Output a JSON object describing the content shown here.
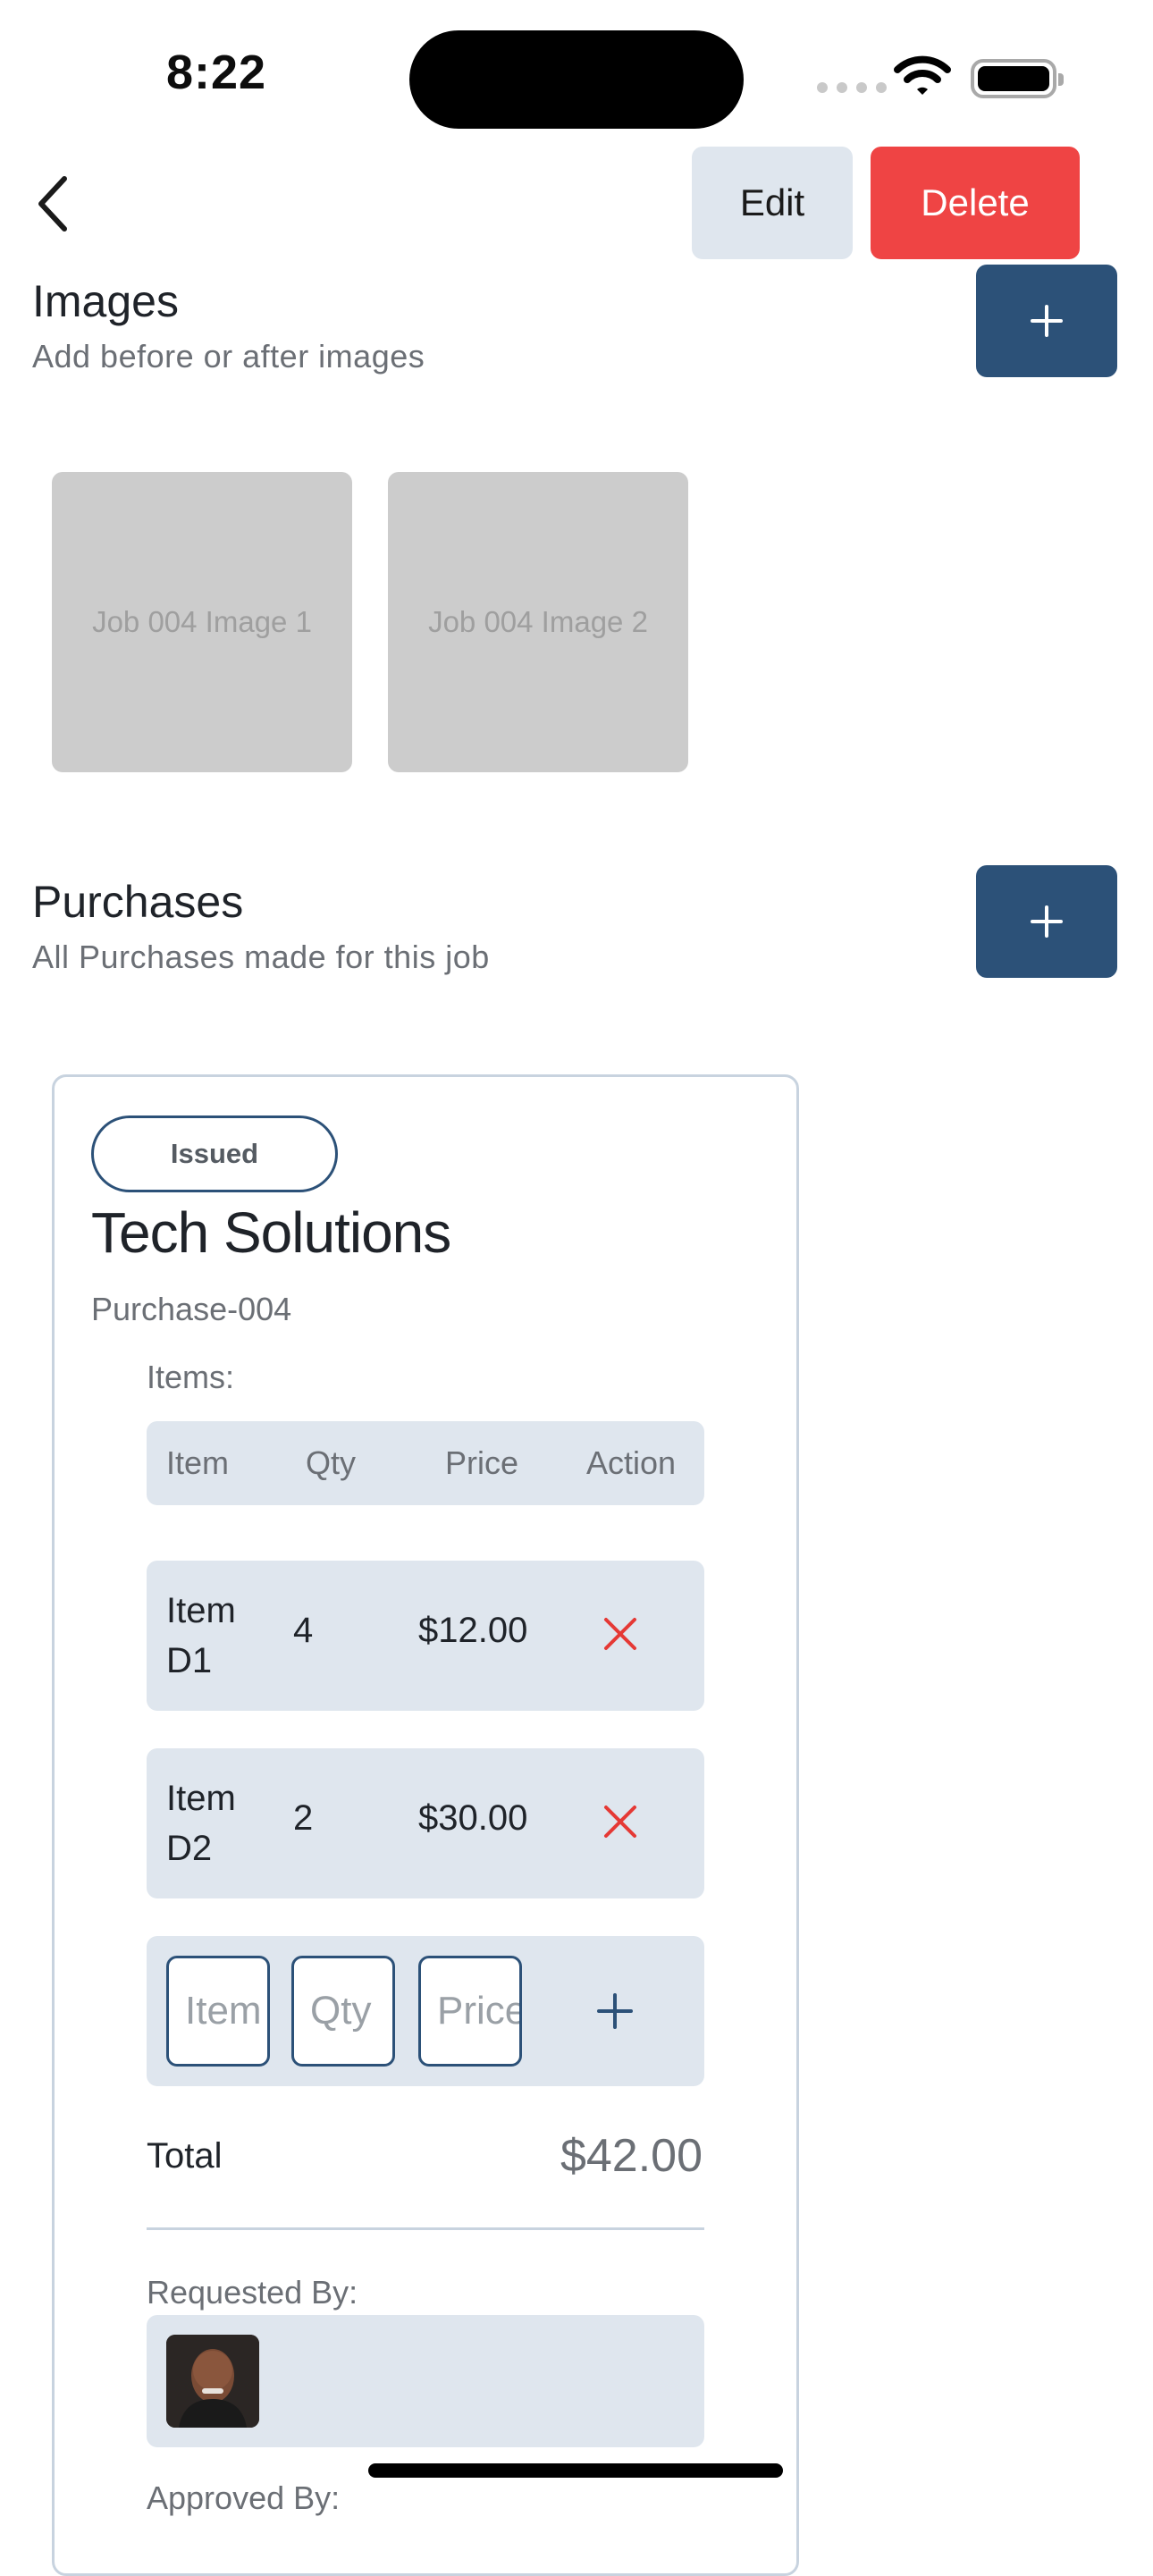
{
  "status_bar": {
    "time": "8:22"
  },
  "nav": {
    "edit_label": "Edit",
    "delete_label": "Delete"
  },
  "images_section": {
    "title": "Images",
    "subtitle": "Add before or after images",
    "thumbnails": [
      "Job 004 Image 1",
      "Job 004 Image 2"
    ]
  },
  "purchases_section": {
    "title": "Purchases",
    "subtitle": "All Purchases made for this job"
  },
  "purchase": {
    "status": "Issued",
    "vendor": "Tech Solutions",
    "id": "Purchase-004",
    "items_label": "Items:",
    "columns": [
      "Item",
      "Qty",
      "Price",
      "Action"
    ],
    "items": [
      {
        "name": "Item D1",
        "qty": "4",
        "price": "$12.00"
      },
      {
        "name": "Item D2",
        "qty": "2",
        "price": "$30.00"
      }
    ],
    "new_item": {
      "item_placeholder": "Item",
      "qty_placeholder": "Qty",
      "price_placeholder": "Price"
    },
    "total_label": "Total",
    "total_value": "$42.00",
    "requested_by_label": "Requested By:",
    "approved_by_label": "Approved By:"
  },
  "colors": {
    "primary": "#2c5178",
    "danger": "#ef4444",
    "surface": "#dfe6ee"
  }
}
